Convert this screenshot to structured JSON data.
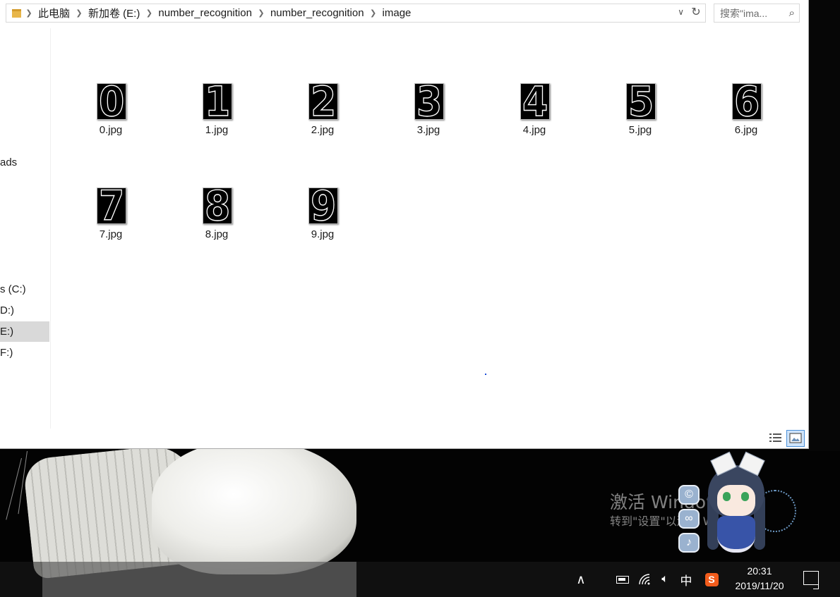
{
  "explorer": {
    "breadcrumb": [
      "此电脑",
      "新加卷 (E:)",
      "number_recognition",
      "number_recognition",
      "image"
    ],
    "search_placeholder": "搜索\"ima...",
    "nav_items": [
      {
        "label": "ads",
        "selected": false
      },
      {
        "label": "s (C:)",
        "selected": false
      },
      {
        "label": "D:)",
        "selected": false
      },
      {
        "label": "E:)",
        "selected": true
      },
      {
        "label": "F:)",
        "selected": false
      }
    ],
    "files": [
      {
        "name": "0.jpg",
        "glyph": "0"
      },
      {
        "name": "1.jpg",
        "glyph": "1"
      },
      {
        "name": "2.jpg",
        "glyph": "2"
      },
      {
        "name": "3.jpg",
        "glyph": "3"
      },
      {
        "name": "4.jpg",
        "glyph": "4"
      },
      {
        "name": "5.jpg",
        "glyph": "5"
      },
      {
        "name": "6.jpg",
        "glyph": "6"
      },
      {
        "name": "7.jpg",
        "glyph": "7"
      },
      {
        "name": "8.jpg",
        "glyph": "8"
      },
      {
        "name": "9.jpg",
        "glyph": "9"
      }
    ],
    "view_mode": "large-icons"
  },
  "watermark": {
    "title": "激活 Windows",
    "subtitle": "转到\"设置\"以激活 Windows。"
  },
  "mascot": {
    "buttons": [
      "©",
      "∞",
      "♪"
    ]
  },
  "taskbar": {
    "ime": "中",
    "sogou": "S",
    "time": "20:31",
    "date": "2019/11/20"
  },
  "colors": {
    "selection": "#d9d9d9",
    "view_active": "#cfe4fa",
    "sogou": "#f25c1c"
  }
}
